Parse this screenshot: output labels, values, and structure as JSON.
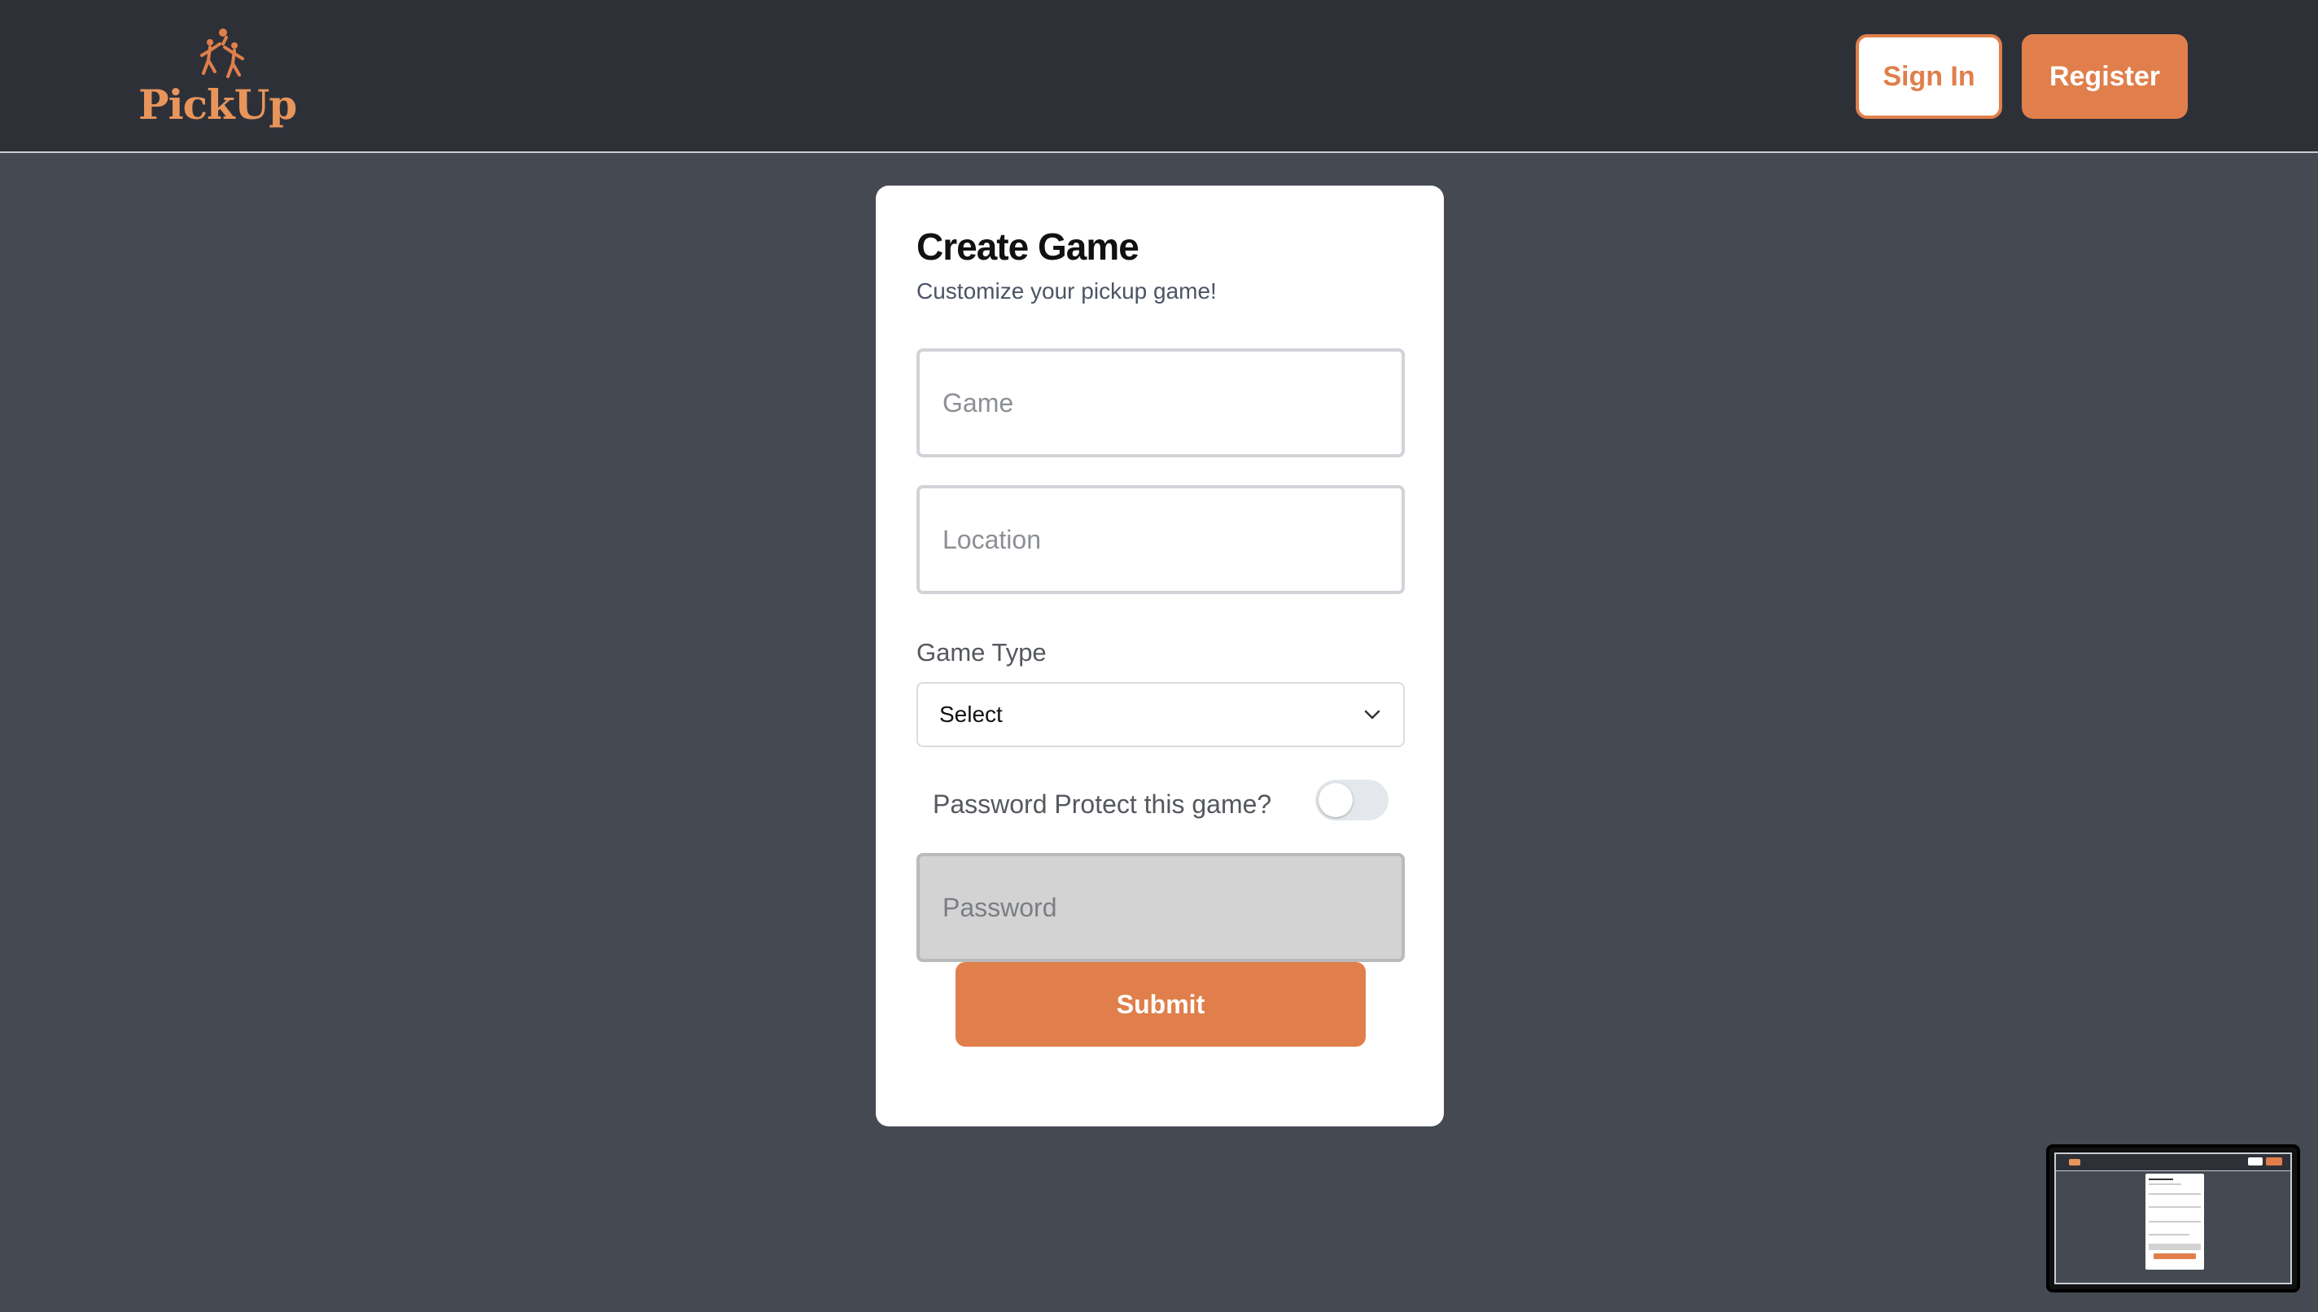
{
  "header": {
    "logo_text": "PickUp",
    "sign_in_label": "Sign In",
    "register_label": "Register"
  },
  "form": {
    "title": "Create Game",
    "subtitle": "Customize your pickup game!",
    "game_placeholder": "Game",
    "location_placeholder": "Location",
    "game_type_label": "Game Type",
    "game_type_value": "Select",
    "password_toggle_label": "Password Protect this game?",
    "password_toggle_on": false,
    "password_placeholder": "Password",
    "submit_label": "Submit"
  },
  "colors": {
    "accent": "#e07f4b",
    "header_bg": "#2e3038",
    "page_bg": "#454952"
  },
  "icons": {
    "logo": "basketball-players-icon",
    "select_arrow": "chevron-down-icon"
  }
}
